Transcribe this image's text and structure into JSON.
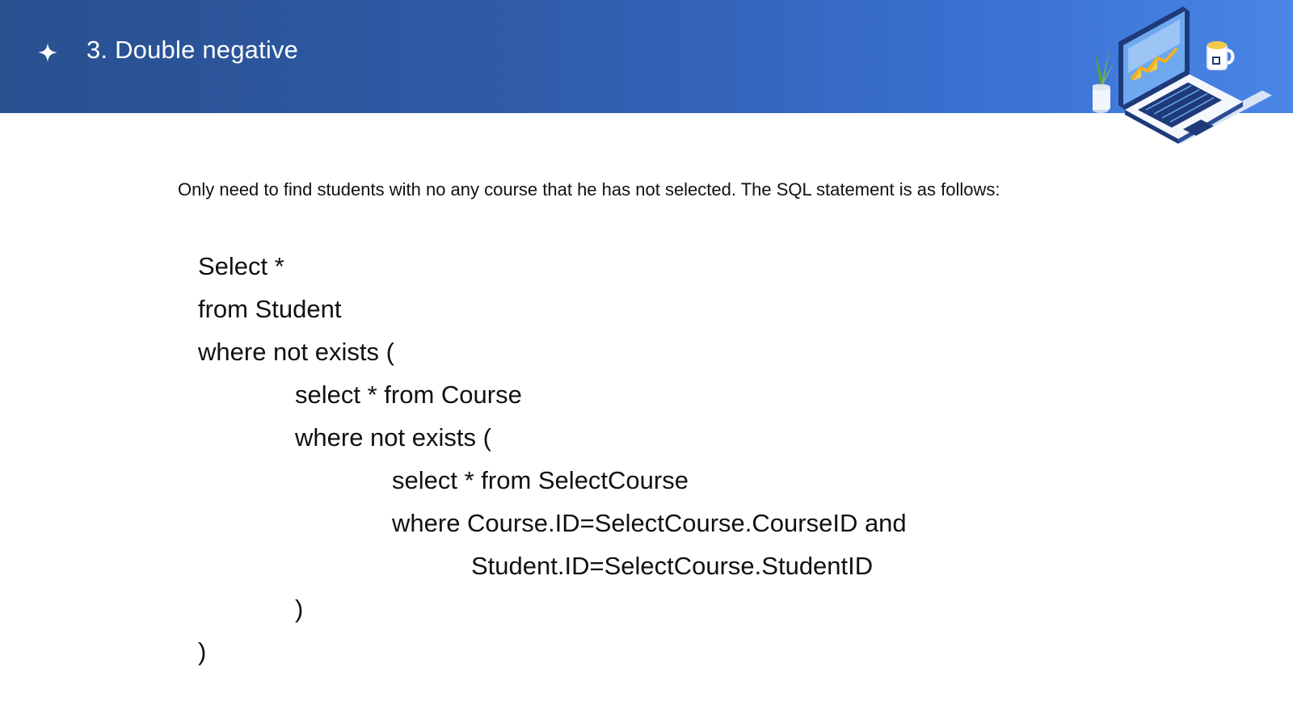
{
  "header": {
    "title": "3. Double negative",
    "bullet_icon": "sparkle-icon",
    "illustration_icon": "laptop-illustration"
  },
  "intro_text": "Only need to find students with no any course that he has not selected. The SQL statement is as follows:",
  "sql_lines": [
    "Select *",
    "from Student",
    "where not exists (",
    "select * from Course",
    "where not exists (",
    "select * from SelectCourse",
    "where Course.ID=SelectCourse.CourseID and",
    "Student.ID=SelectCourse.StudentID",
    ")",
    ")"
  ],
  "colors": {
    "header_start": "#29508f",
    "header_end": "#4a86e6",
    "text": "#111111",
    "title_text": "#ffffff"
  }
}
